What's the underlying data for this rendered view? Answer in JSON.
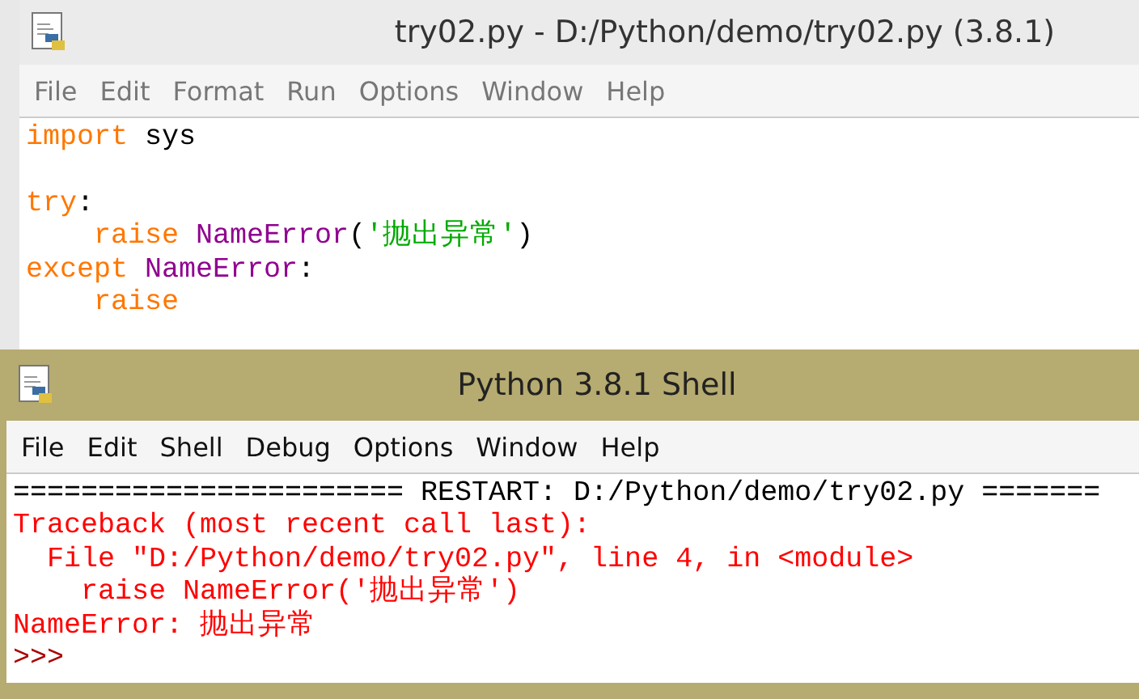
{
  "windows": [
    {
      "title": "try02.py - D:/Python/demo/try02.py (3.8.1)",
      "active": false,
      "menu": [
        "File",
        "Edit",
        "Format",
        "Run",
        "Options",
        "Window",
        "Help"
      ],
      "lines": [
        {
          "kind": "code",
          "tokens": [
            {
              "kind": "keyword",
              "text": "import"
            },
            {
              "kind": "plain",
              "text": " sys"
            }
          ]
        },
        {
          "kind": "blank"
        },
        {
          "kind": "code",
          "tokens": [
            {
              "kind": "keyword",
              "text": "try"
            },
            {
              "kind": "plain",
              "text": ":"
            }
          ]
        },
        {
          "kind": "code",
          "tokens": [
            {
              "kind": "keyword",
              "text": "    raise"
            },
            {
              "kind": "builtin",
              "text": " NameError"
            },
            {
              "kind": "plain",
              "text": "("
            },
            {
              "kind": "string",
              "text": "'抛出异常'"
            },
            {
              "kind": "plain",
              "text": ")"
            }
          ]
        },
        {
          "kind": "code",
          "tokens": [
            {
              "kind": "keyword",
              "text": "except"
            },
            {
              "kind": "builtin",
              "text": " NameError"
            },
            {
              "kind": "plain",
              "text": ":"
            }
          ]
        },
        {
          "kind": "code",
          "tokens": [
            {
              "kind": "keyword",
              "text": "    raise"
            }
          ]
        }
      ]
    },
    {
      "title": "Python 3.8.1 Shell",
      "active": true,
      "menu": [
        "File",
        "Edit",
        "Shell",
        "Debug",
        "Options",
        "Window",
        "Help"
      ],
      "lines": [
        {
          "kind": "code",
          "tokens": [
            {
              "kind": "plain",
              "text": "======================= RESTART: D:/Python/demo/try02.py ======="
            }
          ]
        },
        {
          "kind": "code",
          "tokens": [
            {
              "kind": "error",
              "text": "Traceback (most recent call last):"
            }
          ]
        },
        {
          "kind": "code",
          "tokens": [
            {
              "kind": "error",
              "text": "  File \"D:/Python/demo/try02.py\", line 4, in <module>"
            }
          ]
        },
        {
          "kind": "code",
          "tokens": [
            {
              "kind": "error",
              "text": "    raise NameError('抛出异常')"
            }
          ]
        },
        {
          "kind": "code",
          "tokens": [
            {
              "kind": "error",
              "text": "NameError: 抛出异常"
            }
          ]
        },
        {
          "kind": "code",
          "tokens": [
            {
              "kind": "prompt",
              "text": ">>>"
            }
          ]
        }
      ]
    }
  ]
}
